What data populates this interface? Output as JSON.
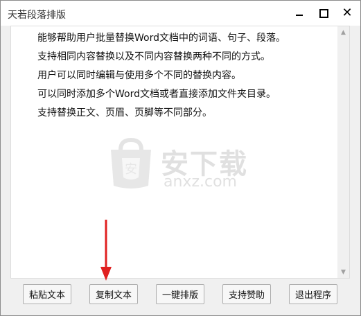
{
  "window": {
    "title": "天若段落排版"
  },
  "editor": {
    "lines": [
      "能够帮助用户批量替换Word文档中的词语、句子、段落。",
      "支持相同内容替换以及不同内容替换两种不同的方式。",
      "用户可以同时编辑与使用多个不同的替换内容。",
      "可以同时添加多个Word文档或者直接添加文件夹目录。",
      "支持替换正文、页眉、页脚等不同部分。"
    ]
  },
  "watermark": {
    "text": "安下载",
    "sub": "anxz.com"
  },
  "buttons": {
    "paste": "粘贴文本",
    "copy": "复制文本",
    "format": "一键排版",
    "support": "支持赞助",
    "exit": "退出程序"
  },
  "colors": {
    "annotation_arrow": "#e02020",
    "watermark": "#c8c8c8"
  }
}
